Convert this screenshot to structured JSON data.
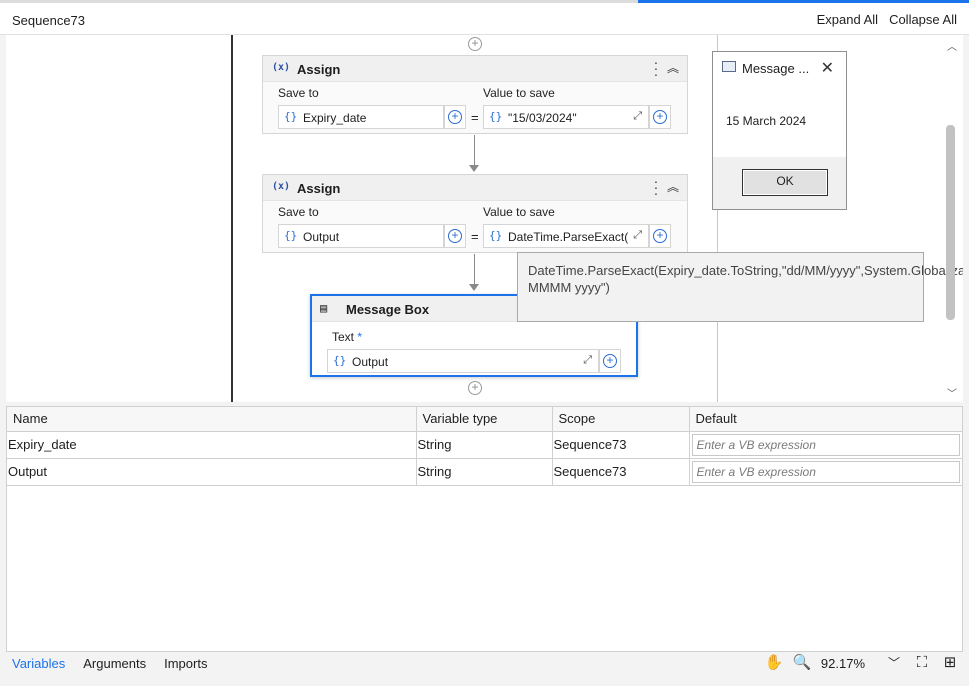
{
  "header": {
    "title": "Sequence73",
    "expand_all": "Expand All",
    "collapse_all": "Collapse All"
  },
  "canvas": {
    "assign1": {
      "title": "Assign",
      "save_to_label": "Save to",
      "value_label": "Value to save",
      "save_to_value": "Expiry_date",
      "value": "\"15/03/2024\""
    },
    "assign2": {
      "title": "Assign",
      "save_to_label": "Save to",
      "value_label": "Value to save",
      "save_to_value": "Output",
      "value": "DateTime.ParseExact(E"
    },
    "message_box": {
      "title": "Message Box",
      "text_label": "Text",
      "required_mark": "*",
      "text_value": "Output"
    },
    "tooltip": "DateTime.ParseExact(Expiry_date.ToString,\"dd/MM/yyyy\",System.Globalization.CultureInfo.InvariantCulture).ToString(\"dd MMMM yyyy\")"
  },
  "dialog": {
    "title": "Message ...",
    "message": "15 March 2024",
    "ok_label": "OK"
  },
  "variables": {
    "columns": [
      "Name",
      "Variable type",
      "Scope",
      "Default"
    ],
    "default_placeholder": "Enter a VB expression",
    "rows": [
      {
        "name": "Expiry_date",
        "type": "String",
        "scope": "Sequence73"
      },
      {
        "name": "Output",
        "type": "String",
        "scope": "Sequence73"
      }
    ]
  },
  "footer": {
    "tabs": [
      "Variables",
      "Arguments",
      "Imports"
    ],
    "zoom": "92.17%"
  },
  "icons": {
    "assign": "assign-icon",
    "message_box": "message-box-icon",
    "hand": "hand-pan-icon",
    "zoom": "zoom-magnifier-icon",
    "fit": "fit-to-screen-icon",
    "fullscreen": "fullscreen-icon"
  },
  "colors": {
    "accent": "#1a73e8"
  }
}
